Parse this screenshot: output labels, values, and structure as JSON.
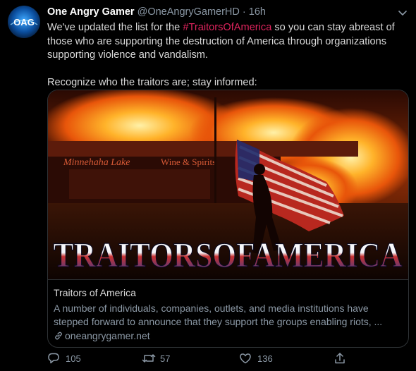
{
  "tweet": {
    "display_name": "One Angry Gamer",
    "handle": "@OneAngryGamerHD",
    "separator": "·",
    "time": "16h",
    "text_before_hashtag": "We've updated the list for the ",
    "hashtag": "#TraitorsOfAmerica",
    "text_after_hashtag": " so you can stay abreast of those who are supporting the destruction of America through organizations supporting violence and vandalism.",
    "text_second_paragraph": "Recognize who the traitors are; stay informed:"
  },
  "avatar": {
    "text": "OAG"
  },
  "card": {
    "image_sign_text": "Minnehaha Lake",
    "image_sign_text_2": "Wine & Spirits",
    "image_overlay_text": "TRAITORSOFAMERICA",
    "title": "Traitors of America",
    "description": "A number of individuals, companies, outlets, and media institutions have stepped forward to announce that they support the groups enabling riots, ...",
    "domain": "oneangrygamer.net"
  },
  "actions": {
    "replies": "105",
    "retweets": "57",
    "likes": "136"
  },
  "colors": {
    "background": "#000000",
    "hashtag": "#e0245e",
    "secondary_text": "#8b98a5",
    "border": "#2f3336"
  }
}
